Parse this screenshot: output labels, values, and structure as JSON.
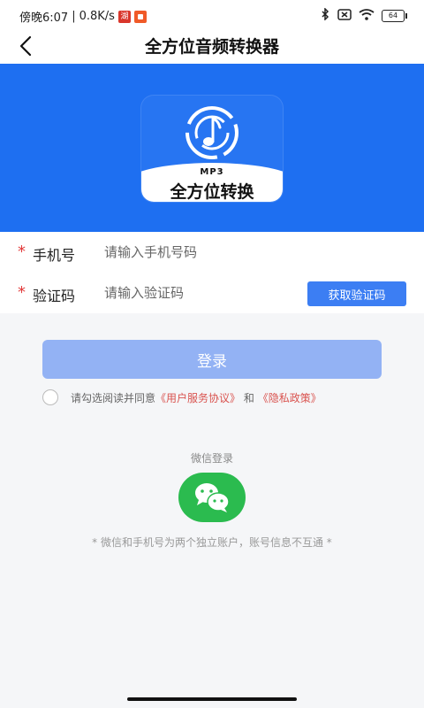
{
  "status_bar": {
    "time": "傍晚6:07",
    "divider": "|",
    "speed": "0.8K/s",
    "badge_1": "湖",
    "badge_1_color": "#d9362b",
    "badge_2_color": "#f05a28",
    "battery": "64"
  },
  "nav": {
    "title": "全方位音频转换器"
  },
  "banner": {
    "background_color": "#1e6ff1",
    "logo_caption": "MP3",
    "logo_name": "全方位转换"
  },
  "form": {
    "phone": {
      "required_mark": "*",
      "label": "手机号",
      "placeholder": "请输入手机号码",
      "value": ""
    },
    "code": {
      "required_mark": "*",
      "label": "验证码",
      "placeholder": "请输入验证码",
      "value": "",
      "button_label": "获取验证码"
    }
  },
  "login": {
    "button_label": "登录",
    "agreement_prefix": "请勾选阅读并同意",
    "user_agreement": "《用户服务协议》",
    "conjunction": "和",
    "privacy_policy": "《隐私政策》",
    "checked": false
  },
  "wechat": {
    "title": "微信登录",
    "icon": "wechat-icon",
    "color": "#2bbb4f",
    "note": "* 微信和手机号为两个独立账户，账号信息不互通 *"
  }
}
